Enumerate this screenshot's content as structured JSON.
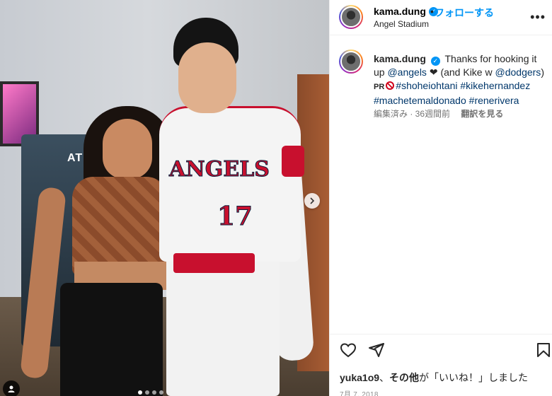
{
  "post": {
    "jersey_team": "ANGELS",
    "jersey_number": "17",
    "atm_label": "ATM"
  },
  "header": {
    "username": "kama.dung",
    "separator": "•",
    "follow_label": "フォローする",
    "location": "Angel Stadium",
    "more_icon": "more-horizontal-icon"
  },
  "caption": {
    "username": "kama.dung",
    "text_1": "Thanks for hooking it up ",
    "mention_angels": "@angels",
    "heart": "❤",
    "text_2": " (and Kike w ",
    "mention_dodgers": "@dodgers",
    "text_3": ")",
    "pr_prefix": "PR",
    "tag_1": "#shoheiohtani",
    "tag_2": "#kikehernandez",
    "tag_3": "#machetemaldonado",
    "tag_4": "#renerivera",
    "edited": "編集済み · 36週間前",
    "see_translation": "翻訳を見る"
  },
  "actions": {
    "likes_user": "yuka1o9",
    "likes_sep": "、",
    "likes_others": "その他",
    "likes_suffix": "が「いいね！」しました",
    "date": "7月 7, 2018"
  },
  "colors": {
    "accent": "#0095f6",
    "link": "#00376b",
    "angels_red": "#c8102e"
  }
}
